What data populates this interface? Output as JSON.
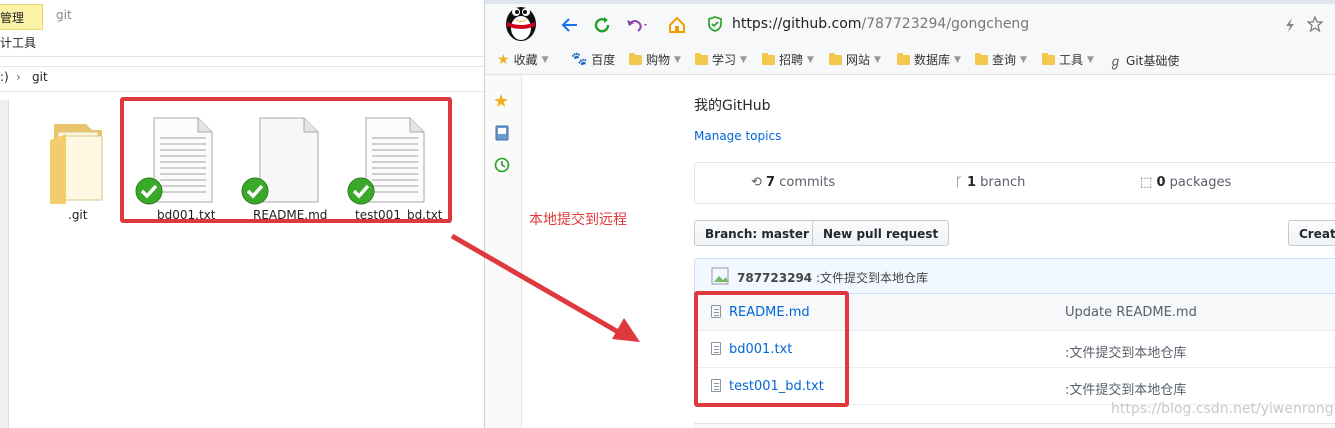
{
  "explorer": {
    "ribbon_tab_manage": "管理",
    "ribbon_tab_tools": "计工具",
    "window_title": "git",
    "address_prefix": ":)",
    "address_sep": "›",
    "address_folder": "git",
    "files": [
      {
        "name": ".git",
        "kind": "folder"
      },
      {
        "name": "bd001.txt",
        "kind": "text"
      },
      {
        "name": "README.md",
        "kind": "blank"
      },
      {
        "name": "test001_bd.txt",
        "kind": "text"
      }
    ]
  },
  "annotation_text": "本地提交到远程",
  "browser": {
    "url_scheme": "https://",
    "url_host": "github.com",
    "url_path": "/787723294/gongcheng",
    "bookmarks": [
      {
        "label": "收藏",
        "icon": "star-icon",
        "caret": true
      },
      {
        "label": "百度",
        "icon": "baidu-paw-icon",
        "caret": false
      },
      {
        "label": "购物",
        "icon": "folder-icon",
        "caret": true
      },
      {
        "label": "学习",
        "icon": "folder-icon",
        "caret": true
      },
      {
        "label": "招聘",
        "icon": "folder-icon",
        "caret": true
      },
      {
        "label": "网站",
        "icon": "folder-icon",
        "caret": true
      },
      {
        "label": "数据库",
        "icon": "folder-icon",
        "caret": true
      },
      {
        "label": "查询",
        "icon": "folder-icon",
        "caret": true
      },
      {
        "label": "工具",
        "icon": "folder-icon",
        "caret": true
      },
      {
        "label": "Git基础使",
        "icon": "git-icon",
        "caret": false
      }
    ]
  },
  "repo": {
    "description": "我的GitHub",
    "manage_topics": "Manage topics",
    "commits_count": "7",
    "commits_label": "commits",
    "branch_count": "1",
    "branch_label": "branch",
    "packages_count": "0",
    "packages_label": "packages",
    "branch_button": "Branch: master",
    "new_pr_button": "New pull request",
    "create_button": "Create",
    "last_commit_user": "787723294",
    "last_commit_msg": ":文件提交到本地仓库",
    "files": [
      {
        "name": "README.md",
        "message": "Update README.md"
      },
      {
        "name": "bd001.txt",
        "message": ":文件提交到本地仓库"
      },
      {
        "name": "test001_bd.txt",
        "message": ":文件提交到本地仓库"
      }
    ]
  },
  "watermark": "https://blog.csdn.net/yiwenrong",
  "colors": {
    "annotation_red": "#e0393d",
    "link_blue": "#0366d6",
    "check_green": "#3aa829"
  }
}
